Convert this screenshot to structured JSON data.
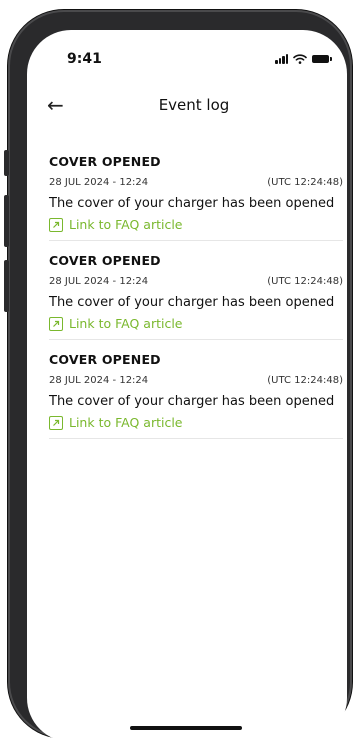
{
  "status": {
    "time": "9:41"
  },
  "header": {
    "back_icon": "arrow-left-icon",
    "title": "Event log"
  },
  "events": [
    {
      "title": "COVER OPENED",
      "date": "28 JUL 2024 - 12:24",
      "utc": "(UTC 12:24:48)",
      "description": "The cover of your charger has been opened",
      "link_label": "Link to FAQ article"
    },
    {
      "title": "COVER OPENED",
      "date": "28 JUL 2024 - 12:24",
      "utc": "(UTC 12:24:48)",
      "description": "The cover of your charger has been opened",
      "link_label": "Link to FAQ article"
    },
    {
      "title": "COVER OPENED",
      "date": "28 JUL 2024 - 12:24",
      "utc": "(UTC 12:24:48)",
      "description": "The cover of your charger has been opened",
      "link_label": "Link to FAQ article"
    }
  ],
  "colors": {
    "accent": "#7ab82e",
    "divider": "#e6e6e6",
    "text": "#111111"
  }
}
